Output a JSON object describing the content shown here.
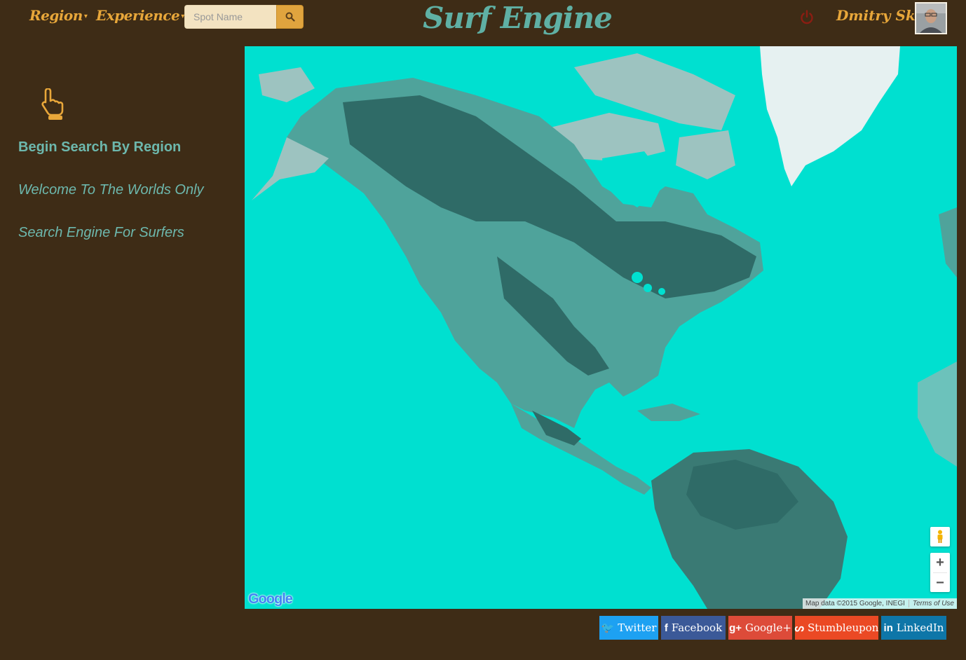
{
  "nav": {
    "region_label": "Region",
    "experience_label": "Experience",
    "search_placeholder": "Spot Name",
    "brand": "Surf Engine",
    "username": "Dmitry Sky"
  },
  "sidebar": {
    "heading": "Begin Search By Region",
    "line1": "Welcome To The Worlds Only",
    "line2": "Search Engine For Surfers"
  },
  "map": {
    "logo": "Google",
    "attribution": "Map data ©2015 Google, INEGI",
    "terms": "Terms of Use",
    "zoom_in": "+",
    "zoom_out": "−",
    "water_color": "#00e0d0"
  },
  "social": [
    {
      "label": "Twitter",
      "icon": "twitter-icon",
      "color": "#1da1f2"
    },
    {
      "label": "Facebook",
      "icon": "facebook-icon",
      "color": "#3b5998"
    },
    {
      "label": "Google+",
      "icon": "google-plus-icon",
      "color": "#dd4b39"
    },
    {
      "label": "Stumbleupon",
      "icon": "stumbleupon-icon",
      "color": "#eb4924"
    },
    {
      "label": "LinkedIn",
      "icon": "linkedin-icon",
      "color": "#0e76a8"
    }
  ],
  "colors": {
    "background": "#3e2c16",
    "accent_gold": "#e8a73a",
    "accent_teal": "#5fb0a4"
  }
}
